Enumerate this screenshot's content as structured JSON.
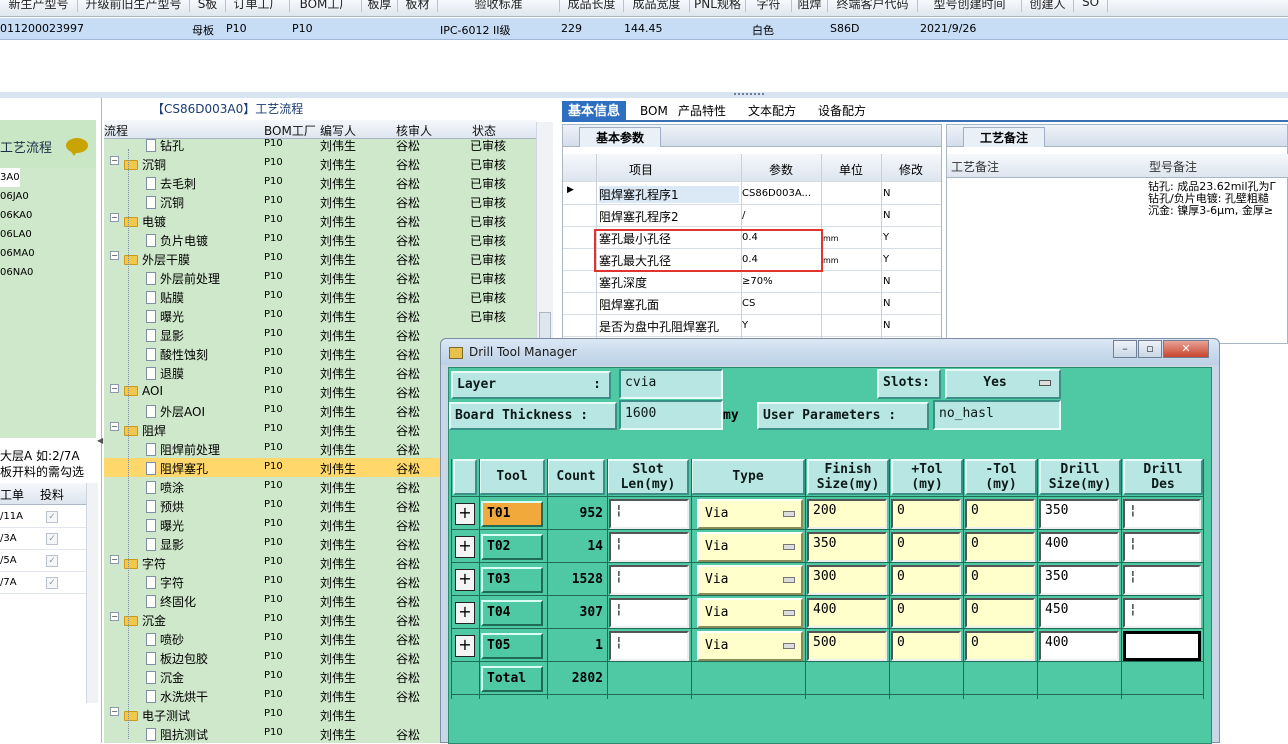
{
  "top_grid": {
    "headers": [
      "新生产型号",
      "升级前旧生产型号",
      "S板",
      "订单工厂",
      "BOM工厂",
      "板厚",
      "板材",
      "验收标准",
      "成品长度",
      "成品宽度",
      "PNL规格",
      "字符",
      "阻焊",
      "终端客户代码",
      "型号创建时间",
      "创建人",
      "SO"
    ],
    "row": {
      "code": "011200023997",
      "board": "母板",
      "order_factory": "P10",
      "bom_factory": "P10",
      "standard": "IPC-6012 II级",
      "length": "229",
      "width": "144.45",
      "char": "白色",
      "customer": "S86D",
      "created": "2021/9/26"
    }
  },
  "left_panel": {
    "title": "工艺流程",
    "codes": [
      "3A0",
      "06JA0",
      "06KA0",
      "06LA0",
      "06MA0",
      "06NA0"
    ],
    "tip_lines": [
      "大层A 如:2/7A",
      "板开料的需勾选"
    ],
    "grid_headers": [
      "工单",
      "投料"
    ],
    "rows": [
      "/11A",
      "/3A",
      "/5A",
      "/7A"
    ]
  },
  "tree_panel": {
    "title": "【CS86D003A0】工艺流程",
    "headers": [
      "流程",
      "BOM工厂",
      "编写人",
      "核审人",
      "状态"
    ],
    "rows": [
      {
        "name": "钻孔",
        "level": 2,
        "bom": "P10",
        "writer": "刘伟生",
        "reviewer": "谷松",
        "status": "已审核"
      },
      {
        "name": "沉铜",
        "level": 1,
        "bom": "P10",
        "writer": "刘伟生",
        "reviewer": "谷松",
        "status": "已审核"
      },
      {
        "name": "去毛刺",
        "level": 2,
        "bom": "P10",
        "writer": "刘伟生",
        "reviewer": "谷松",
        "status": "已审核"
      },
      {
        "name": "沉铜",
        "level": 2,
        "bom": "P10",
        "writer": "刘伟生",
        "reviewer": "谷松",
        "status": "已审核"
      },
      {
        "name": "电镀",
        "level": 1,
        "bom": "P10",
        "writer": "刘伟生",
        "reviewer": "谷松",
        "status": "已审核"
      },
      {
        "name": "负片电镀",
        "level": 2,
        "bom": "P10",
        "writer": "刘伟生",
        "reviewer": "谷松",
        "status": "已审核"
      },
      {
        "name": "外层干膜",
        "level": 1,
        "bom": "P10",
        "writer": "刘伟生",
        "reviewer": "谷松",
        "status": "已审核"
      },
      {
        "name": "外层前处理",
        "level": 2,
        "bom": "P10",
        "writer": "刘伟生",
        "reviewer": "谷松",
        "status": "已审核"
      },
      {
        "name": "贴膜",
        "level": 2,
        "bom": "P10",
        "writer": "刘伟生",
        "reviewer": "谷松",
        "status": "已审核"
      },
      {
        "name": "曝光",
        "level": 2,
        "bom": "P10",
        "writer": "刘伟生",
        "reviewer": "谷松",
        "status": "已审核"
      },
      {
        "name": "显影",
        "level": 2,
        "bom": "P10",
        "writer": "刘伟生",
        "reviewer": "谷松",
        "status": ""
      },
      {
        "name": "酸性蚀刻",
        "level": 2,
        "bom": "P10",
        "writer": "刘伟生",
        "reviewer": "谷松",
        "status": ""
      },
      {
        "name": "退膜",
        "level": 2,
        "bom": "P10",
        "writer": "刘伟生",
        "reviewer": "谷松",
        "status": ""
      },
      {
        "name": "AOI",
        "level": 1,
        "bom": "P10",
        "writer": "刘伟生",
        "reviewer": "谷松",
        "status": ""
      },
      {
        "name": "外层AOI",
        "level": 2,
        "bom": "P10",
        "writer": "刘伟生",
        "reviewer": "谷松",
        "status": ""
      },
      {
        "name": "阻焊",
        "level": 1,
        "bom": "P10",
        "writer": "刘伟生",
        "reviewer": "谷松",
        "status": ""
      },
      {
        "name": "阻焊前处理",
        "level": 2,
        "bom": "P10",
        "writer": "刘伟生",
        "reviewer": "谷松",
        "status": ""
      },
      {
        "name": "阻焊塞孔",
        "level": 2,
        "bom": "P10",
        "writer": "刘伟生",
        "reviewer": "谷松",
        "status": "",
        "selected": true
      },
      {
        "name": "喷涂",
        "level": 2,
        "bom": "P10",
        "writer": "刘伟生",
        "reviewer": "谷松",
        "status": ""
      },
      {
        "name": "预烘",
        "level": 2,
        "bom": "P10",
        "writer": "刘伟生",
        "reviewer": "谷松",
        "status": ""
      },
      {
        "name": "曝光",
        "level": 2,
        "bom": "P10",
        "writer": "刘伟生",
        "reviewer": "谷松",
        "status": ""
      },
      {
        "name": "显影",
        "level": 2,
        "bom": "P10",
        "writer": "刘伟生",
        "reviewer": "谷松",
        "status": ""
      },
      {
        "name": "字符",
        "level": 1,
        "bom": "P10",
        "writer": "刘伟生",
        "reviewer": "谷松",
        "status": ""
      },
      {
        "name": "字符",
        "level": 2,
        "bom": "P10",
        "writer": "刘伟生",
        "reviewer": "谷松",
        "status": ""
      },
      {
        "name": "终固化",
        "level": 2,
        "bom": "P10",
        "writer": "刘伟生",
        "reviewer": "谷松",
        "status": ""
      },
      {
        "name": "沉金",
        "level": 1,
        "bom": "P10",
        "writer": "刘伟生",
        "reviewer": "谷松",
        "status": ""
      },
      {
        "name": "喷砂",
        "level": 2,
        "bom": "P10",
        "writer": "刘伟生",
        "reviewer": "谷松",
        "status": ""
      },
      {
        "name": "板边包胶",
        "level": 2,
        "bom": "P10",
        "writer": "刘伟生",
        "reviewer": "谷松",
        "status": ""
      },
      {
        "name": "沉金",
        "level": 2,
        "bom": "P10",
        "writer": "刘伟生",
        "reviewer": "谷松",
        "status": ""
      },
      {
        "name": "水洗烘干",
        "level": 2,
        "bom": "P10",
        "writer": "刘伟生",
        "reviewer": "谷松",
        "status": ""
      },
      {
        "name": "电子测试",
        "level": 1,
        "bom": "P10",
        "writer": "刘伟生",
        "reviewer": "",
        "status": ""
      },
      {
        "name": "阻抗测试",
        "level": 2,
        "bom": "P10",
        "writer": "刘伟生",
        "reviewer": "谷松",
        "status": ""
      }
    ]
  },
  "tabs": [
    "基本信息",
    "BOM",
    "产品特性",
    "文本配方",
    "设备配方"
  ],
  "basic_panel": {
    "subtitle": "基本参数",
    "headers": [
      "项目",
      "参数",
      "单位",
      "修改"
    ],
    "rows": [
      {
        "item": "阻焊塞孔程序1",
        "param": "CS86D003A...",
        "unit": "",
        "mod": "N"
      },
      {
        "item": "阻焊塞孔程序2",
        "param": "/",
        "unit": "",
        "mod": "N"
      },
      {
        "item": "塞孔最小孔径",
        "param": "0.4",
        "unit": "mm",
        "mod": "Y"
      },
      {
        "item": "塞孔最大孔径",
        "param": "0.4",
        "unit": "mm",
        "mod": "Y"
      },
      {
        "item": "塞孔深度",
        "param": "≥70%",
        "unit": "",
        "mod": "N"
      },
      {
        "item": "阻焊塞孔面",
        "param": "CS",
        "unit": "",
        "mod": "N"
      },
      {
        "item": "是否为盘中孔阻焊塞孔",
        "param": "Y",
        "unit": "",
        "mod": "N"
      }
    ]
  },
  "notes_panel": {
    "subtitle": "工艺备注",
    "headers": [
      "工艺备注",
      "型号备注"
    ],
    "note_lines": [
      "钻孔: 成品23.62mil孔为Γ",
      "钻孔/负片电镀: 孔壁粗糙",
      "沉金: 镍厚3-6μm, 金厚≥"
    ]
  },
  "dialog": {
    "title": "Drill Tool Manager",
    "layer_label": "Layer",
    "layer_colon": ":",
    "layer_value": "cvia",
    "slots_label": "Slots:",
    "slots_value": "Yes",
    "thickness_label": "Board Thickness :",
    "thickness_value": "1600",
    "thickness_unit": "my",
    "user_params_label": "User Parameters :",
    "user_params_value": "no_hasl",
    "columns": [
      [
        "Tool"
      ],
      [
        "Count"
      ],
      [
        "Slot",
        "Len(my)"
      ],
      [
        "Type"
      ],
      [
        "Finish",
        "Size(my)"
      ],
      [
        "+Tol",
        "(my)"
      ],
      [
        "-Tol",
        "(my)"
      ],
      [
        "Drill",
        "Size(my)"
      ],
      [
        "Drill",
        "Des"
      ]
    ],
    "tools": [
      {
        "name": "T01",
        "count": "952",
        "type": "Via",
        "finish": "200",
        "ptol": "0",
        "ntol": "0",
        "drill": "350",
        "selected": true
      },
      {
        "name": "T02",
        "count": "14",
        "type": "Via",
        "finish": "350",
        "ptol": "0",
        "ntol": "0",
        "drill": "400"
      },
      {
        "name": "T03",
        "count": "1528",
        "type": "Via",
        "finish": "300",
        "ptol": "0",
        "ntol": "0",
        "drill": "350"
      },
      {
        "name": "T04",
        "count": "307",
        "type": "Via",
        "finish": "400",
        "ptol": "0",
        "ntol": "0",
        "drill": "450"
      },
      {
        "name": "T05",
        "count": "1",
        "type": "Via",
        "finish": "500",
        "ptol": "0",
        "ntol": "0",
        "drill": "400"
      }
    ],
    "total_label": "Total",
    "total_count": "2802"
  },
  "colors": {
    "dialog_bg": "#4ec9a4",
    "selected_tool": "#f2a93b",
    "tab_active": "#2f6fc1",
    "tree_bg": "#cfe8cb",
    "highlight_box": "#e0342c"
  }
}
